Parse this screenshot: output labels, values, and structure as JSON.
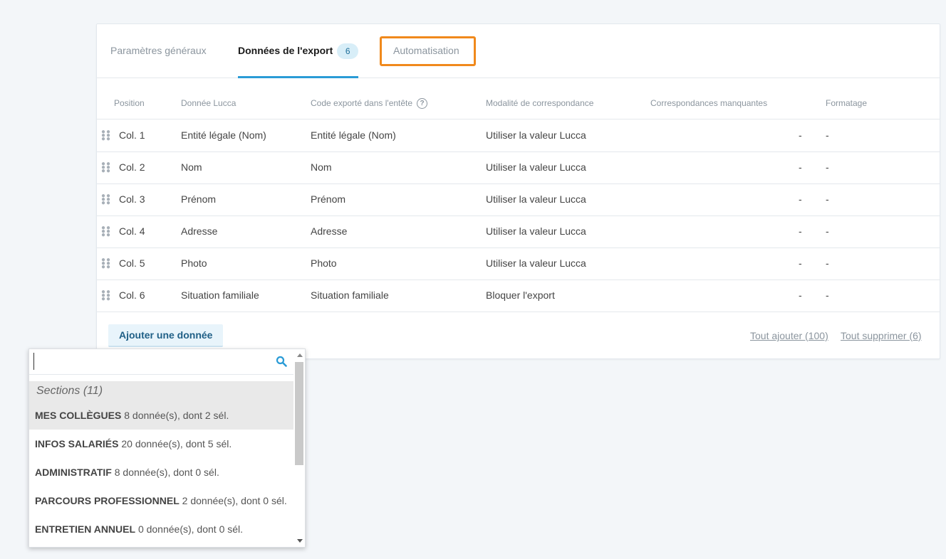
{
  "tabs": [
    {
      "label": "Paramètres généraux"
    },
    {
      "label": "Données de l'export",
      "badge": "6"
    },
    {
      "label": "Automatisation"
    }
  ],
  "table": {
    "headers": [
      "Position",
      "Donnée Lucca",
      "Code exporté dans l'entête",
      "Modalité de correspondance",
      "Correspondances manquantes",
      "Formatage"
    ],
    "help_icon": "?",
    "rows": [
      {
        "position": "Col. 1",
        "donnee": "Entité légale (Nom)",
        "code": "Entité légale (Nom)",
        "modalite": "Utiliser la valeur Lucca",
        "manquantes": "-",
        "formatage": "-"
      },
      {
        "position": "Col. 2",
        "donnee": "Nom",
        "code": "Nom",
        "modalite": "Utiliser la valeur Lucca",
        "manquantes": "-",
        "formatage": "-"
      },
      {
        "position": "Col. 3",
        "donnee": "Prénom",
        "code": "Prénom",
        "modalite": "Utiliser la valeur Lucca",
        "manquantes": "-",
        "formatage": "-"
      },
      {
        "position": "Col. 4",
        "donnee": "Adresse",
        "code": "Adresse",
        "modalite": "Utiliser la valeur Lucca",
        "manquantes": "-",
        "formatage": "-"
      },
      {
        "position": "Col. 5",
        "donnee": "Photo",
        "code": "Photo",
        "modalite": "Utiliser la valeur Lucca",
        "manquantes": "-",
        "formatage": "-"
      },
      {
        "position": "Col. 6",
        "donnee": "Situation familiale",
        "code": "Situation familiale",
        "modalite": "Bloquer l'export",
        "manquantes": "-",
        "formatage": "-"
      }
    ]
  },
  "actions": {
    "add_label": "Ajouter une donnée",
    "add_all_label": "Tout ajouter (100)",
    "remove_all_label": "Tout supprimer (6)"
  },
  "dropdown": {
    "search_value": "",
    "group_label": "Sections (11)",
    "items": [
      {
        "name": "MES COLLÈGUES",
        "detail": "8 donnée(s), dont 2 sél."
      },
      {
        "name": "INFOS SALARIÉS",
        "detail": "20 donnée(s), dont 5 sél."
      },
      {
        "name": "ADMINISTRATIF",
        "detail": "8 donnée(s), dont 0 sél."
      },
      {
        "name": "PARCOURS PROFESSIONNEL",
        "detail": "2 donnée(s), dont 0 sél."
      },
      {
        "name": "ENTRETIEN ANNUEL",
        "detail": "0 donnée(s), dont 0 sél."
      }
    ]
  },
  "colors": {
    "accent": "#2a9bd6",
    "highlight": "#f0891c",
    "background": "#f3f6f9"
  }
}
